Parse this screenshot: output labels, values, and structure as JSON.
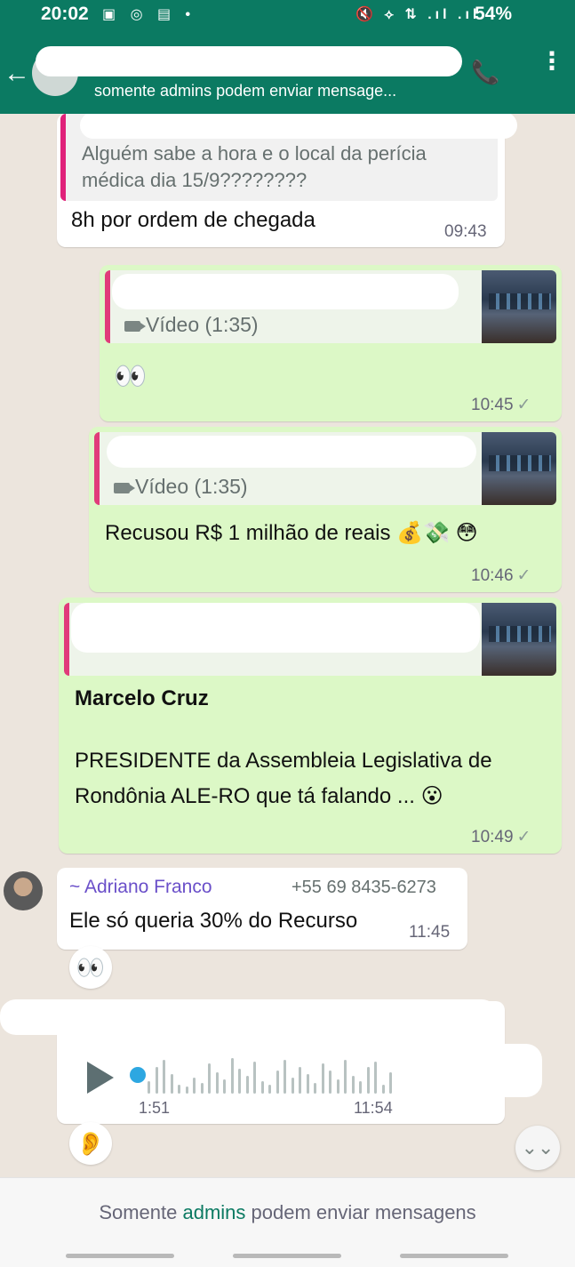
{
  "status_bar": {
    "time": "20:02",
    "left_icons": "▣ ◎ ▤ •",
    "right_icons": "🔇 ⟡ ⇅ .ıl .ıl",
    "battery": "54%"
  },
  "header": {
    "subtitle": "somente admins podem enviar mensage...",
    "back_icon": "←",
    "call_icon": "📞",
    "menu_icon": "⋮"
  },
  "messages": {
    "m1": {
      "quote_text": "Alguém sabe a hora e o local da perícia médica dia 15/9????????",
      "text": "8h por ordem de chegada",
      "time": "09:43"
    },
    "m2": {
      "quote_label": "Vídeo (1:35)",
      "text": "👀",
      "time": "10:45"
    },
    "m3": {
      "quote_label": "Vídeo (1:35)",
      "text": "Recusou R$ 1 milhão de reais 💰💸 😳",
      "time": "10:46"
    },
    "m4": {
      "heading": "Marcelo Cruz",
      "text": "PRESIDENTE da Assembleia Legislativa de Rondônia ALE-RO que tá falando ... 😮",
      "time": "10:49"
    },
    "m5": {
      "sender": "~ Adriano Franco",
      "phone": "+55 69 8435-6273",
      "text": "Ele só queria 30% do Recurso",
      "time": "11:45",
      "reaction": "👀"
    },
    "m6": {
      "duration": "1:51",
      "time": "11:54",
      "reaction": "👂"
    }
  },
  "tick": "✓",
  "scroll_icon": "⌄⌄",
  "footer": {
    "prefix": "Somente ",
    "admins": "admins",
    "suffix": " podem enviar mensagens"
  },
  "colors": {
    "header": "#0b7a62",
    "outgoing": "#dcf8c6",
    "incoming": "#ffffff",
    "chat_bg": "#ece5dd"
  }
}
